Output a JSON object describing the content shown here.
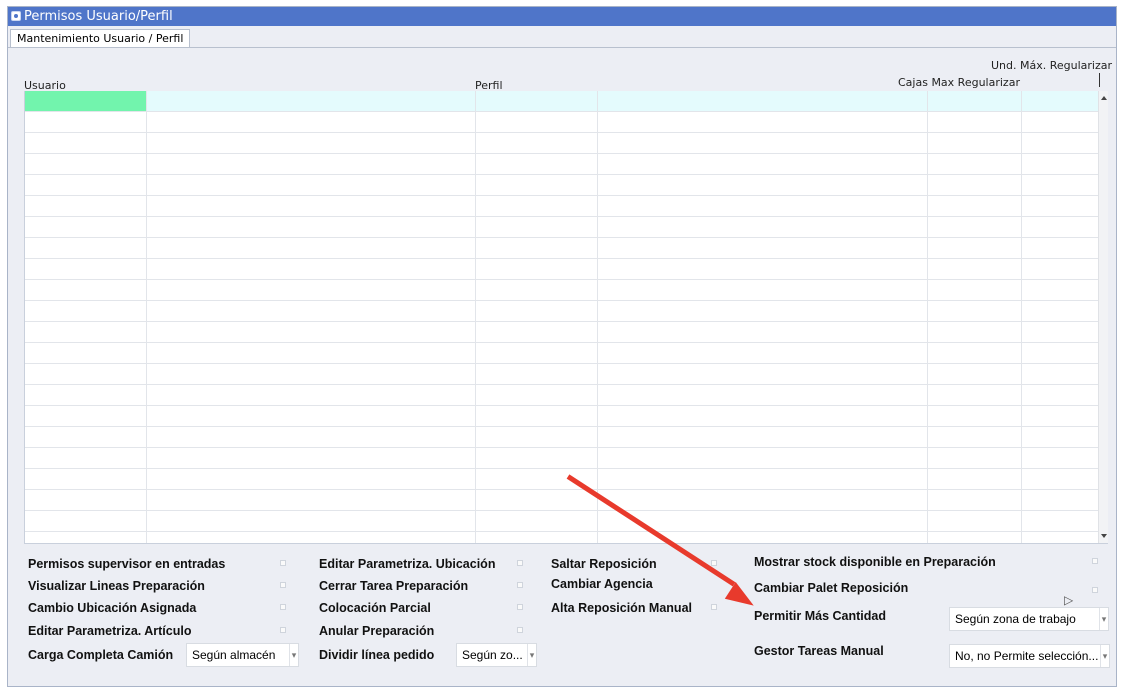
{
  "window": {
    "title": "Permisos Usuario/Perfil"
  },
  "tabs": [
    {
      "label": "Mantenimiento Usuario / Perfil"
    }
  ],
  "grid": {
    "headers": {
      "usuario": "Usuario",
      "perfil": "Perfil",
      "und_max": "Und. Máx. Regularizar",
      "cajas_max": "Cajas Max Regularizar"
    }
  },
  "permissions": {
    "col1": [
      "Permisos supervisor en entradas",
      "Visualizar Lineas Preparación",
      "Cambio Ubicación Asignada",
      "Editar Parametriza. Artículo"
    ],
    "col2": [
      "Editar Parametriza. Ubicación",
      "Cerrar Tarea Preparación",
      "Colocación Parcial",
      "Anular Preparación"
    ],
    "col3": [
      "Saltar Reposición",
      "Cambiar Agencia",
      "Alta Reposición Manual"
    ],
    "col4": [
      "Mostrar stock disponible en Preparación",
      "Cambiar Palet Reposición"
    ]
  },
  "selects": {
    "carga_completa": {
      "label": "Carga Completa Camión",
      "value": "Según almacén"
    },
    "dividir_linea": {
      "label": "Dividir línea pedido",
      "value": "Según zo..."
    },
    "permitir_mas": {
      "label": "Permitir Más Cantidad",
      "value": "Según zona de trabajo"
    },
    "gestor_tareas": {
      "label": "Gestor Tareas Manual",
      "value": "No, no Permite selección..."
    }
  },
  "colors": {
    "titlebar": "#4f75c9",
    "selected_cell": "#72f4ad",
    "first_row": "#e4fbfd",
    "annotation_arrow": "#e83a2c"
  }
}
